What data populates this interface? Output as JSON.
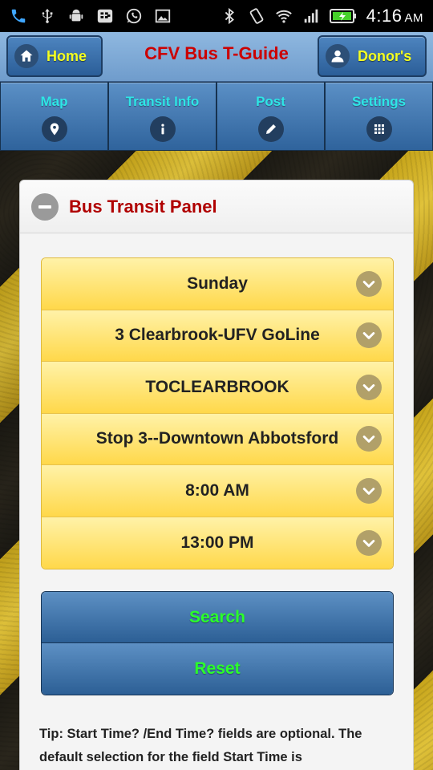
{
  "status_bar": {
    "time": "4:16",
    "ampm": "AM",
    "icons": [
      "phone-icon",
      "usb-icon",
      "android-debug-icon",
      "bbm-icon",
      "whatsapp-icon",
      "gallery-icon",
      "bluetooth-icon",
      "vibrate-icon",
      "wifi-icon",
      "signal-icon",
      "battery-charging-icon"
    ]
  },
  "header": {
    "home_label": "Home",
    "title": "CFV Bus T-Guide",
    "donor_label": "Donor's"
  },
  "nav": {
    "tabs": [
      {
        "label": "Map",
        "icon": "map-pin-icon"
      },
      {
        "label": "Transit Info",
        "icon": "info-icon"
      },
      {
        "label": "Post",
        "icon": "pencil-icon"
      },
      {
        "label": "Settings",
        "icon": "grid-icon"
      }
    ]
  },
  "panel": {
    "title": "Bus Transit Panel",
    "selects": [
      {
        "value": "Sunday"
      },
      {
        "value": "3 Clearbrook-UFV GoLine"
      },
      {
        "value": "TOCLEARBROOK"
      },
      {
        "value": "Stop 3--Downtown Abbotsford"
      },
      {
        "value": "8:00 AM"
      },
      {
        "value": "13:00 PM"
      }
    ],
    "search_label": "Search",
    "reset_label": "Reset",
    "tip": "Tip: Start Time? /End Time? fields are optional. The default selection for the field Start Time is"
  },
  "colors": {
    "title_red": "#cc0000",
    "accent_yellow": "#f4ff22",
    "nav_cyan": "#2ee6e6",
    "action_green": "#2bff2b",
    "select_gold": "#ffd84a",
    "button_blue": "#2c5f95"
  }
}
